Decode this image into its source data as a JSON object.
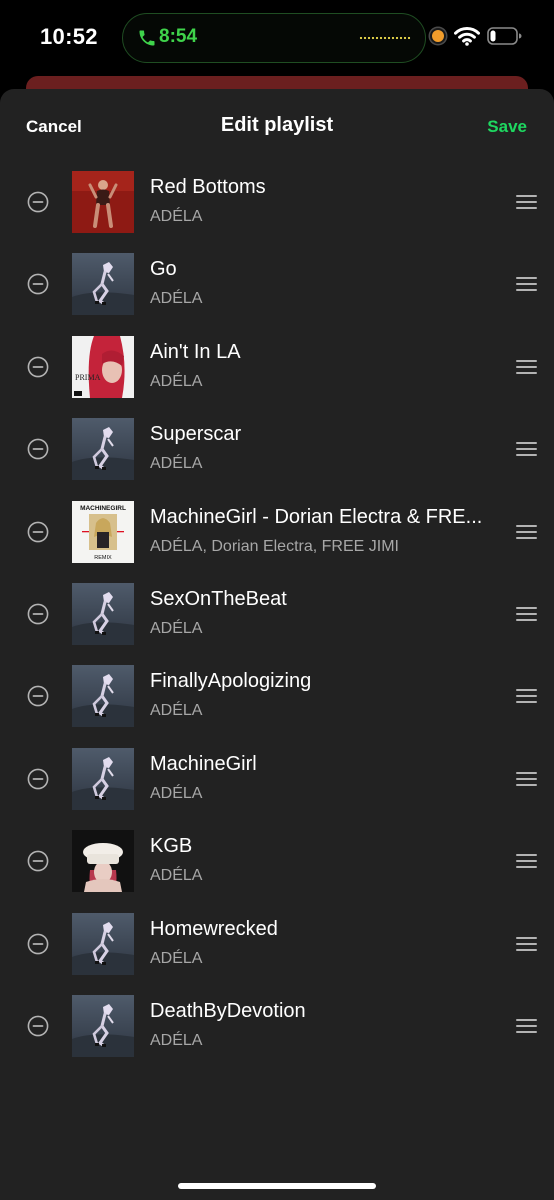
{
  "status_bar": {
    "time": "10:52",
    "call_timer": "8:54",
    "icons": [
      "phone-icon",
      "wifi-icon",
      "battery-icon"
    ]
  },
  "header": {
    "cancel_label": "Cancel",
    "title": "Edit playlist",
    "save_label": "Save"
  },
  "colors": {
    "accent_green": "#1ed760",
    "sheet_background": "#222222",
    "secondary_text": "#a7a7a7"
  },
  "tracks": [
    {
      "title": "Red Bottoms",
      "artist": "ADÉLA",
      "artwork": "red-bottoms-art"
    },
    {
      "title": "Go",
      "artist": "ADÉLA",
      "artwork": "album-art-dancer"
    },
    {
      "title": "Ain't In LA",
      "artist": "ADÉLA",
      "artwork": "aint-in-la-art"
    },
    {
      "title": "Superscar",
      "artist": "ADÉLA",
      "artwork": "album-art-dancer"
    },
    {
      "title": "MachineGirl - Dorian Electra & FRE...",
      "artist": "ADÉLA, Dorian Electra, FREE JIMI",
      "artwork": "machinegirl-remix-art"
    },
    {
      "title": "SexOnTheBeat",
      "artist": "ADÉLA",
      "artwork": "album-art-dancer"
    },
    {
      "title": "FinallyApologizing",
      "artist": "ADÉLA",
      "artwork": "album-art-dancer"
    },
    {
      "title": "MachineGirl",
      "artist": "ADÉLA",
      "artwork": "album-art-dancer"
    },
    {
      "title": "KGB",
      "artist": "ADÉLA",
      "artwork": "kgb-art"
    },
    {
      "title": "Homewrecked",
      "artist": "ADÉLA",
      "artwork": "album-art-dancer"
    },
    {
      "title": "DeathByDevotion",
      "artist": "ADÉLA",
      "artwork": "album-art-dancer"
    }
  ],
  "artwork_text": {
    "aint_in_la": "PRIMA",
    "machinegirl_top": "MACHINEGIRL",
    "machinegirl_bottom": "REMIX"
  }
}
